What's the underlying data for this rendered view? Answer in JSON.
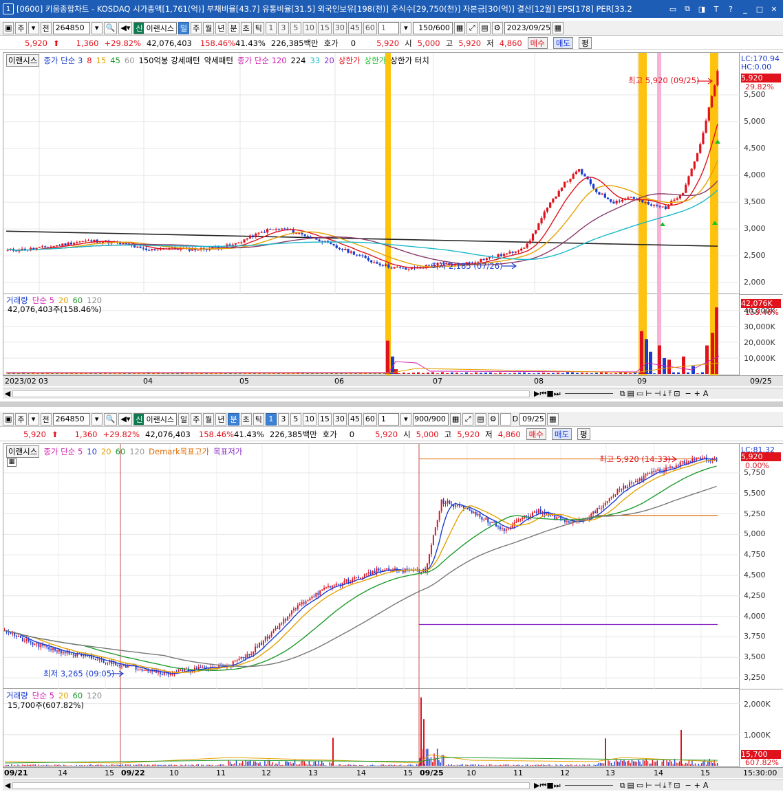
{
  "titlebar": {
    "app_num": "1",
    "text": "[0600] 키움종합차트 - KOSDAQ 시가총액[1,761(억)] 부채비율[43.7] 유통비율[31.5] 외국인보유[198(천)] 주식수[29,750(천)] 자본금[30(억)] 결산[12월] EPS[178] PER[33.2",
    "buttons": [
      "▭",
      "⧉",
      "◨",
      "T",
      "?",
      "_",
      "□",
      "✕"
    ]
  },
  "common": {
    "market_label": "주",
    "prev_label": "전",
    "code": "264850",
    "sin_label": "신",
    "stock_name": "이랜시스",
    "quote": {
      "price": "5,920",
      "arrow": "⬆",
      "change": "1,360",
      "change_pct": "+29.82%",
      "volume": "42,076,403",
      "vol_pct": "158.46%",
      "turnover": "41.43%",
      "amount": "226,385백만",
      "hoga_label": "호가",
      "hoga_val": "0",
      "hoga_price": "5,920",
      "open_label": "시",
      "open": "5,000",
      "high_label": "고",
      "high": "5,920",
      "low_label": "저",
      "low": "4,860",
      "buy": "매수",
      "sell": "매도",
      "avg": "평"
    }
  },
  "top": {
    "periods": [
      "일",
      "주",
      "월",
      "년",
      "분",
      "초",
      "틱"
    ],
    "periods_selected": "일",
    "nums": [
      "1",
      "3",
      "5",
      "10",
      "15",
      "30",
      "45",
      "60"
    ],
    "count_sel": "1",
    "count": "150",
    "count_max": "/600",
    "date": "2023/09/25",
    "legend": {
      "name": "이랜시스",
      "ma_label": "종가 단순 3",
      "ma_vals": [
        "8",
        "15",
        "45",
        "60"
      ],
      "ind1": "150억봉 강세패턴",
      "ind2": "약세패턴",
      "ma2_label": "종가 단순 120",
      "ma2_vals": [
        "224",
        "33",
        "20"
      ],
      "sang1": "상한가",
      "sang2": "상한가",
      "sang3": "상한가 터치"
    },
    "price_axis": [
      "5,500",
      "5,000",
      "4,500",
      "4,000",
      "3,500",
      "3,000",
      "2,500",
      "2,000"
    ],
    "lc": "LC:170.94",
    "hc": "HC:0.00",
    "cur_price": "5,920",
    "cur_pct": "29.82%",
    "max_label": "최고 5,920 (09/25)",
    "min_label": "최저 2,185 (07/26)",
    "vol_legend": {
      "label": "거래량",
      "ma": "단순 5",
      "vals": [
        "20",
        "60",
        "120"
      ],
      "value": "42,076,403주(158.46%)"
    },
    "vol_axis": [
      "40,000K",
      "30,000K",
      "20,000K",
      "10,000K"
    ],
    "vol_cur": "42,076K",
    "vol_pct": "158.46%",
    "dates": [
      "2023/02",
      "03",
      "04",
      "05",
      "06",
      "07",
      "08",
      "09",
      "09/25"
    ]
  },
  "bottom": {
    "periods": [
      "일",
      "주",
      "월",
      "년",
      "분",
      "초",
      "틱"
    ],
    "periods_selected": "분",
    "nums": [
      "1",
      "3",
      "5",
      "10",
      "15",
      "30",
      "45",
      "60"
    ],
    "num_selected": "1",
    "count_sel": "1",
    "count": "900",
    "count_max": "/900",
    "d_label": "D",
    "date": "09/25",
    "legend": {
      "name": "이랜시스",
      "ma_label": "종가 단순 5",
      "ma_vals": [
        "10",
        "20",
        "60",
        "120"
      ],
      "demark_hi": "Demark목표고가",
      "demark_lo": "목표저가"
    },
    "price_axis": [
      "5,750",
      "5,500",
      "5,250",
      "5,000",
      "4,750",
      "4,500",
      "4,250",
      "4,000",
      "3,750",
      "3,500",
      "3,250"
    ],
    "lc": "LC:81.32",
    "cur_price": "5,920",
    "cur_pct": "0.00%",
    "max_label": "최고 5,920 (14:33)",
    "min_label": "최저 3,265 (09:05)",
    "vol_legend": {
      "label": "거래량",
      "ma": "단순 5",
      "vals": [
        "20",
        "60",
        "120"
      ],
      "value": "15,700주(607.82%)"
    },
    "vol_axis": [
      "2,000K",
      "1,000K"
    ],
    "vol_cur": "15,700",
    "vol_pct": "607.82%",
    "times": [
      "09/21",
      "14",
      "15",
      "09/22",
      "10",
      "11",
      "12",
      "13",
      "14",
      "15",
      "09/25",
      "10",
      "11",
      "12",
      "13",
      "14",
      "15",
      "15:30:00"
    ]
  },
  "chart_data": [
    {
      "type": "candlestick",
      "title": "",
      "series": [
        {
          "name": "이랜시스 일봉",
          "values": [
            2600,
            2620,
            2650,
            2700,
            2760,
            2780,
            2750,
            2700,
            2600,
            2650,
            2630,
            2620,
            2650,
            2700,
            2850,
            2980,
            3000,
            2900,
            2800,
            2650,
            2550,
            2400,
            2300,
            2250,
            2300,
            2350,
            2330,
            2400,
            2480,
            2550,
            2700,
            3300,
            3800,
            4100,
            3700,
            3500,
            3600,
            3450,
            3400,
            3700,
            4560,
            5920
          ]
        }
      ],
      "ylim": [
        1900,
        6000
      ],
      "min": {
        "label": "최저",
        "value": 2185,
        "date": "07/26"
      },
      "max": {
        "label": "최고",
        "value": 5920,
        "date": "09/25"
      }
    },
    {
      "type": "candlestick",
      "title": "",
      "series": [
        {
          "name": "이랜시스 1분봉",
          "values": [
            3850,
            3720,
            3650,
            3600,
            3550,
            3500,
            3460,
            3420,
            3380,
            3350,
            3300,
            3330,
            3360,
            3380,
            3420,
            3520,
            3700,
            3900,
            4100,
            4250,
            4350,
            4420,
            4480,
            4560,
            4560,
            4560,
            4560,
            5400,
            5350,
            5250,
            5150,
            5050,
            5200,
            5280,
            5200,
            5150,
            5200,
            5350,
            5550,
            5650,
            5750,
            5800,
            5880,
            5920,
            5920
          ]
        }
      ],
      "ylim": [
        3150,
        5950
      ],
      "min": {
        "label": "최저",
        "value": 3265,
        "time": "09:05"
      },
      "max": {
        "label": "최고",
        "value": 5920,
        "time": "14:33"
      }
    }
  ]
}
